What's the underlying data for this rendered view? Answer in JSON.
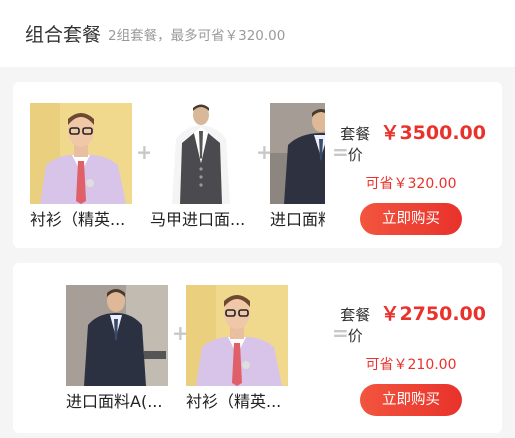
{
  "header": {
    "title": "组合套餐",
    "subtitle": "2组套餐，最多可省￥320.00"
  },
  "packages": [
    {
      "items": [
        {
          "name": "衬衫（精英..."
        },
        {
          "name": "马甲进口面..."
        },
        {
          "name": "进口面料"
        }
      ],
      "price_label": "套餐价",
      "price": "￥3500.00",
      "save": "可省￥320.00",
      "buy_label": "立即购买"
    },
    {
      "items": [
        {
          "name": "进口面料A(..."
        },
        {
          "name": "衬衫（精英..."
        }
      ],
      "price_label": "套餐价",
      "price": "￥2750.00",
      "save": "可省￥210.00",
      "buy_label": "立即购买"
    }
  ],
  "symbols": {
    "plus": "+",
    "equals": "="
  },
  "colors": {
    "accent": "#e8322b",
    "button_start": "#f2553f"
  }
}
